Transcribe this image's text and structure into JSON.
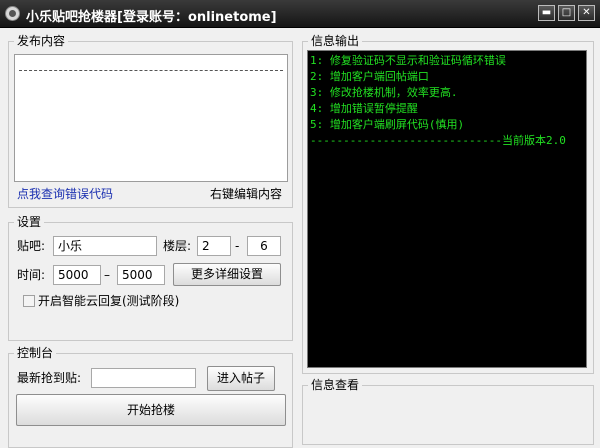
{
  "window": {
    "title": "小乐贴吧抢楼器[登录账号：onlinetome]",
    "buttons": {
      "minimize": "▬",
      "maximize": "□",
      "close": "✕"
    }
  },
  "publish": {
    "legend": "发布内容",
    "query_error_link": "点我查询错误代码",
    "right_click_hint": "右键编辑内容"
  },
  "settings": {
    "legend": "设置",
    "tieba_label": "贴吧:",
    "tieba_value": "小乐",
    "floor_label": "楼层:",
    "floor_from": "2",
    "floor_to": "6",
    "floor_sep": "-",
    "time_label": "时间:",
    "time_from": "5000",
    "time_to": "5000",
    "time_sep": "–",
    "more_settings_button": "更多详细设置",
    "smart_reply_label": "开启智能云回复(测试阶段)"
  },
  "control": {
    "legend": "控制台",
    "latest_label": "最新抢到贴:",
    "latest_value": "",
    "enter_button": "进入帖子",
    "start_button": "开始抢楼"
  },
  "output": {
    "legend": "信息输出",
    "lines": [
      "1: 修复验证码不显示和验证码循环错误",
      "2: 增加客户端回帖端口",
      "3: 修改抢楼机制，效率更高.",
      "4: 增加错误暂停提醒",
      "5: 增加客户端刷屏代码(慎用)",
      "-----------------------------当前版本2.0"
    ]
  },
  "info_view": {
    "legend": "信息查看"
  },
  "colors": {
    "console_text": "#22e022",
    "console_bg": "#000000",
    "link": "#1a2fb0"
  }
}
